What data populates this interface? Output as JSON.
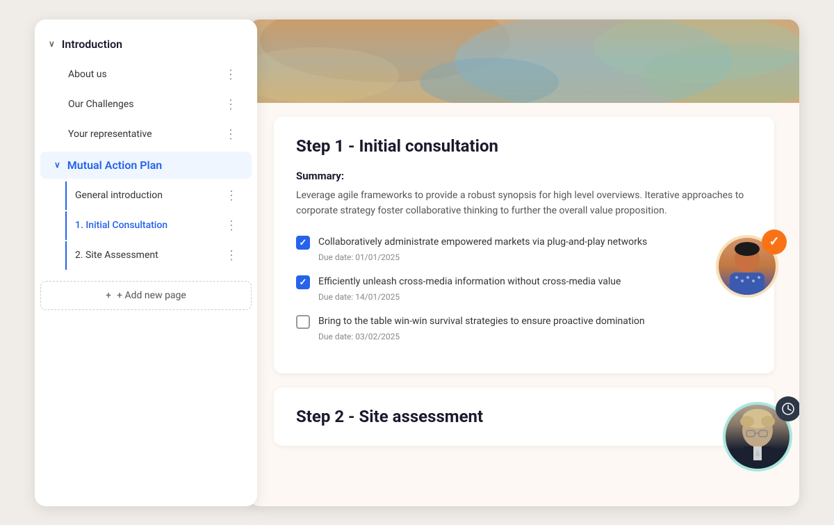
{
  "sidebar": {
    "introduction": {
      "label": "Introduction",
      "expanded": true,
      "items": [
        {
          "id": "about-us",
          "label": "About us"
        },
        {
          "id": "our-challenges",
          "label": "Our Challenges"
        },
        {
          "id": "your-representative",
          "label": "Your representative"
        }
      ]
    },
    "mutualActionPlan": {
      "label": "Mutual Action Plan",
      "expanded": true,
      "items": [
        {
          "id": "general-introduction",
          "label": "General introduction"
        },
        {
          "id": "initial-consultation",
          "label": "1. Initial Consultation",
          "active": true
        },
        {
          "id": "site-assessment",
          "label": "2. Site Assessment"
        }
      ]
    },
    "addNewPage": "+ Add new page"
  },
  "main": {
    "step1": {
      "title": "Step 1 - Initial consultation",
      "summaryLabel": "Summary:",
      "summaryText": "Leverage agile frameworks to provide a robust synopsis for high level overviews. Iterative approaches to corporate strategy foster collaborative thinking to further the overall value proposition.",
      "tasks": [
        {
          "id": "task-1",
          "checked": true,
          "text": "Collaboratively administrate empowered markets via plug-and-play networks",
          "dueDate": "Due date: 01/01/2025"
        },
        {
          "id": "task-2",
          "checked": true,
          "text": "Efficiently unleash cross-media information without cross-media value",
          "dueDate": "Due date: 14/01/2025"
        },
        {
          "id": "task-3",
          "checked": false,
          "text": "Bring to the table win-win survival strategies to ensure proactive domination",
          "dueDate": "Due date: 03/02/2025"
        }
      ]
    },
    "step2": {
      "title": "Step 2 - Site assessment"
    }
  },
  "icons": {
    "chevron_down": "∨",
    "three_dots": "⋮",
    "plus": "+",
    "check": "✓",
    "clock": "🕐",
    "check_circle": "✓"
  },
  "colors": {
    "accent_blue": "#2563eb",
    "accent_orange": "#f97316",
    "accent_teal": "#a8e6df",
    "sidebar_active_bg": "#eff6ff",
    "dark_badge": "#2d3748"
  }
}
